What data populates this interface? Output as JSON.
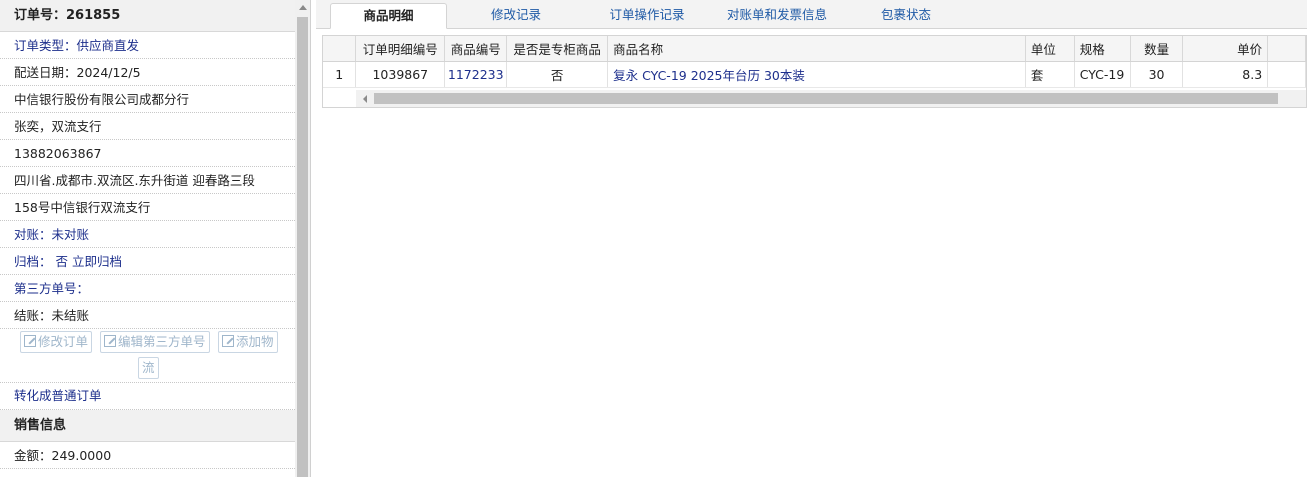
{
  "order": {
    "title": "订单号：261855",
    "type_label": "订单类型：",
    "type_value": "供应商直发",
    "delivery_date": "配送日期：2024/12/5",
    "company": "中信银行股份有限公司成都分行",
    "contact": "张奕，双流支行",
    "phone": "13882063867",
    "address_line1": "四川省.成都市.双流区.东升街道 迎春路三段",
    "address_line2": "158号中信银行双流支行",
    "reconcile_label": "对账：",
    "reconcile_value": "未对账",
    "archive_label": "归档：",
    "archive_value": "否 立即归档",
    "third_party_label": "第三方单号：",
    "settle": "结账：未结账",
    "btn_edit_order": "修改订单",
    "btn_edit_third": "编辑第三方单号",
    "btn_add_logistics_1": "添加物",
    "btn_add_logistics_2": "流",
    "convert_link": "转化成普通订单",
    "sales_title": "销售信息",
    "amount": "金额：249.0000"
  },
  "tabs": [
    "商品明细",
    "修改记录",
    "订单操作记录",
    "对账单和发票信息",
    "包裹状态"
  ],
  "table": {
    "headers": [
      "",
      "订单明细编号",
      "商品编号",
      "是否是专柜商品",
      "商品名称",
      "单位",
      "规格",
      "数量",
      "单价"
    ],
    "rows": [
      [
        "1",
        "1039867",
        "1172233",
        "否",
        "复永 CYC-19 2025年台历 30本装",
        "套",
        "CYC-19",
        "30",
        "8.3"
      ]
    ]
  }
}
